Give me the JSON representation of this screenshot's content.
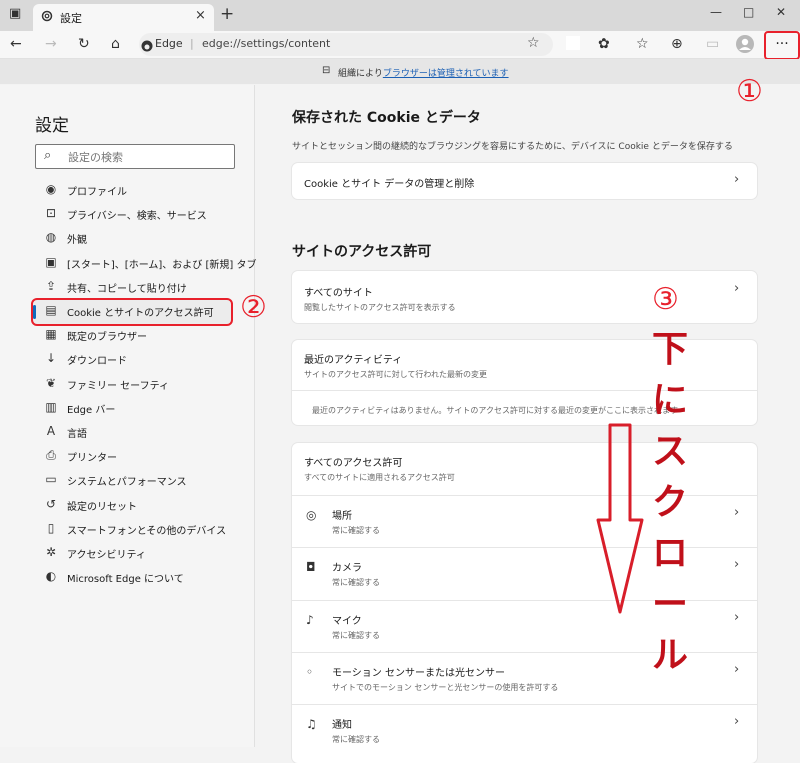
{
  "tab": {
    "title": "設定",
    "close": "×",
    "new_tab": "+"
  },
  "window": {
    "minimize": "—",
    "maximize": "□",
    "close": "✕"
  },
  "address": {
    "label": "Edge",
    "separator": "|",
    "url": "edge://settings/content"
  },
  "toolbar": {
    "more": "···"
  },
  "managed": {
    "prefix": "組織により",
    "link": "ブラウザーは管理されています"
  },
  "sidebar": {
    "title": "設定",
    "search_placeholder": "設定の検索",
    "items": [
      {
        "label": "プロファイル",
        "icon": "profile-icon"
      },
      {
        "label": "プライバシー、検索、サービス",
        "icon": "lock-icon"
      },
      {
        "label": "外観",
        "icon": "palette-icon"
      },
      {
        "label": "[スタート]、[ホーム]、および [新規] タブ",
        "icon": "home-tab-icon"
      },
      {
        "label": "共有、コピーして貼り付け",
        "icon": "share-icon"
      },
      {
        "label": "Cookie とサイトのアクセス許可",
        "icon": "cookie-icon",
        "active": true
      },
      {
        "label": "既定のブラウザー",
        "icon": "browser-icon"
      },
      {
        "label": "ダウンロード",
        "icon": "download-icon"
      },
      {
        "label": "ファミリー セーフティ",
        "icon": "family-icon"
      },
      {
        "label": "Edge バー",
        "icon": "edgebar-icon"
      },
      {
        "label": "言語",
        "icon": "language-icon"
      },
      {
        "label": "プリンター",
        "icon": "printer-icon"
      },
      {
        "label": "システムとパフォーマンス",
        "icon": "system-icon"
      },
      {
        "label": "設定のリセット",
        "icon": "reset-icon"
      },
      {
        "label": "スマートフォンとその他のデバイス",
        "icon": "phone-icon"
      },
      {
        "label": "アクセシビリティ",
        "icon": "accessibility-icon"
      },
      {
        "label": "Microsoft Edge について",
        "icon": "edge-logo-icon"
      }
    ]
  },
  "main": {
    "cookies": {
      "title": "保存された Cookie とデータ",
      "desc": "サイトとセッション間の継続的なブラウジングを容易にするために、デバイスに Cookie とデータを保存する",
      "manage": "Cookie とサイト データの管理と削除"
    },
    "permissions": {
      "title": "サイトのアクセス許可",
      "all_sites": {
        "title": "すべてのサイト",
        "sub": "閲覧したサイトのアクセス許可を表示する"
      },
      "recent": {
        "title": "最近のアクティビティ",
        "sub": "サイトのアクセス許可に対して行われた最新の変更",
        "empty": "最近のアクティビティはありません。サイトのアクセス許可に対する最近の変更がここに表示されます"
      },
      "all_perms": {
        "title": "すべてのアクセス許可",
        "sub": "すべてのサイトに適用されるアクセス許可",
        "items": [
          {
            "title": "場所",
            "sub": "常に確認する",
            "icon": "location-icon"
          },
          {
            "title": "カメラ",
            "sub": "常に確認する",
            "icon": "camera-icon"
          },
          {
            "title": "マイク",
            "sub": "常に確認する",
            "icon": "microphone-icon"
          },
          {
            "title": "モーション センサーまたは光センサー",
            "sub": "サイトでのモーション センサーと光センサーの使用を許可する",
            "icon": "sensor-icon"
          },
          {
            "title": "通知",
            "sub": "常に確認する",
            "icon": "bell-icon"
          }
        ]
      }
    }
  },
  "annotations": {
    "step1": "①",
    "step2": "②",
    "step3": "③",
    "scroll_chars": [
      "下",
      "に",
      "ス",
      "ク",
      "ロ",
      "ー",
      "ル"
    ],
    "color": "#e8212c"
  }
}
